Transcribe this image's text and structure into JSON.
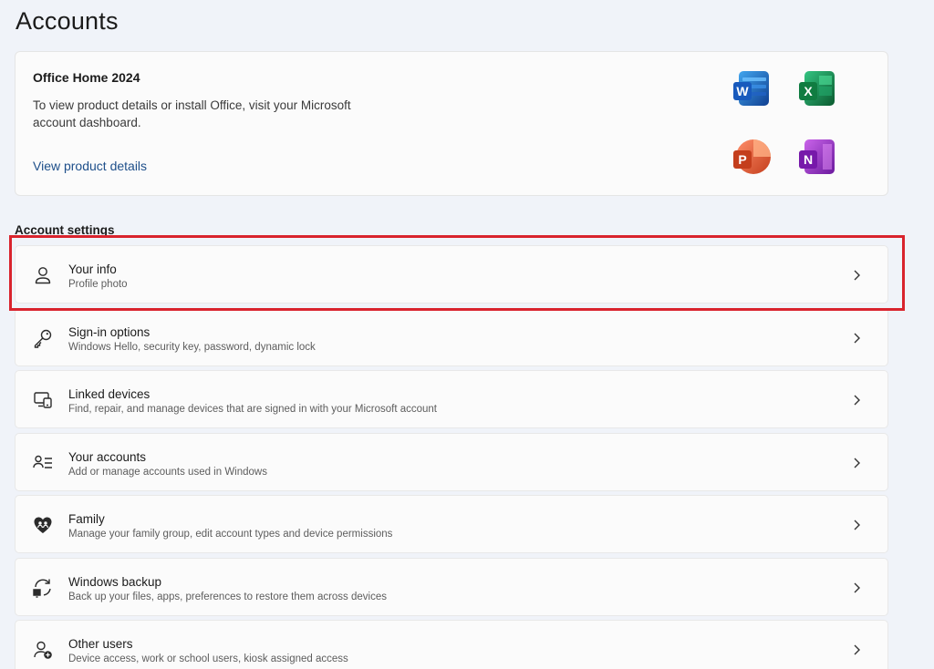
{
  "page": {
    "title": "Accounts"
  },
  "office": {
    "title": "Office Home 2024",
    "description": "To view product details or install Office, visit your Microsoft account dashboard.",
    "link_label": "View product details",
    "apps": [
      {
        "name": "word-icon",
        "letter": "W",
        "color": "#185abd"
      },
      {
        "name": "excel-icon",
        "letter": "X",
        "color": "#107c41"
      },
      {
        "name": "powerpoint-icon",
        "letter": "P",
        "color": "#c43e1c"
      },
      {
        "name": "onenote-icon",
        "letter": "N",
        "color": "#7719aa"
      }
    ]
  },
  "account_settings": {
    "label": "Account settings",
    "items": [
      {
        "id": "your-info",
        "title": "Your info",
        "subtitle": "Profile photo",
        "icon": "person-icon"
      },
      {
        "id": "sign-in-options",
        "title": "Sign-in options",
        "subtitle": "Windows Hello, security key, password, dynamic lock",
        "icon": "key-icon"
      },
      {
        "id": "linked-devices",
        "title": "Linked devices",
        "subtitle": "Find, repair, and manage devices that are signed in with your Microsoft account",
        "icon": "devices-icon"
      },
      {
        "id": "your-accounts",
        "title": "Your accounts",
        "subtitle": "Add or manage accounts used in Windows",
        "icon": "accounts-list-icon"
      },
      {
        "id": "family",
        "title": "Family",
        "subtitle": "Manage your family group, edit account types and device permissions",
        "icon": "family-heart-icon"
      },
      {
        "id": "windows-backup",
        "title": "Windows backup",
        "subtitle": "Back up your files, apps, preferences to restore them across devices",
        "icon": "backup-icon"
      },
      {
        "id": "other-users",
        "title": "Other users",
        "subtitle": "Device access, work or school users, kiosk assigned access",
        "icon": "add-person-icon"
      }
    ]
  },
  "highlight": {
    "color": "#d9232d"
  }
}
